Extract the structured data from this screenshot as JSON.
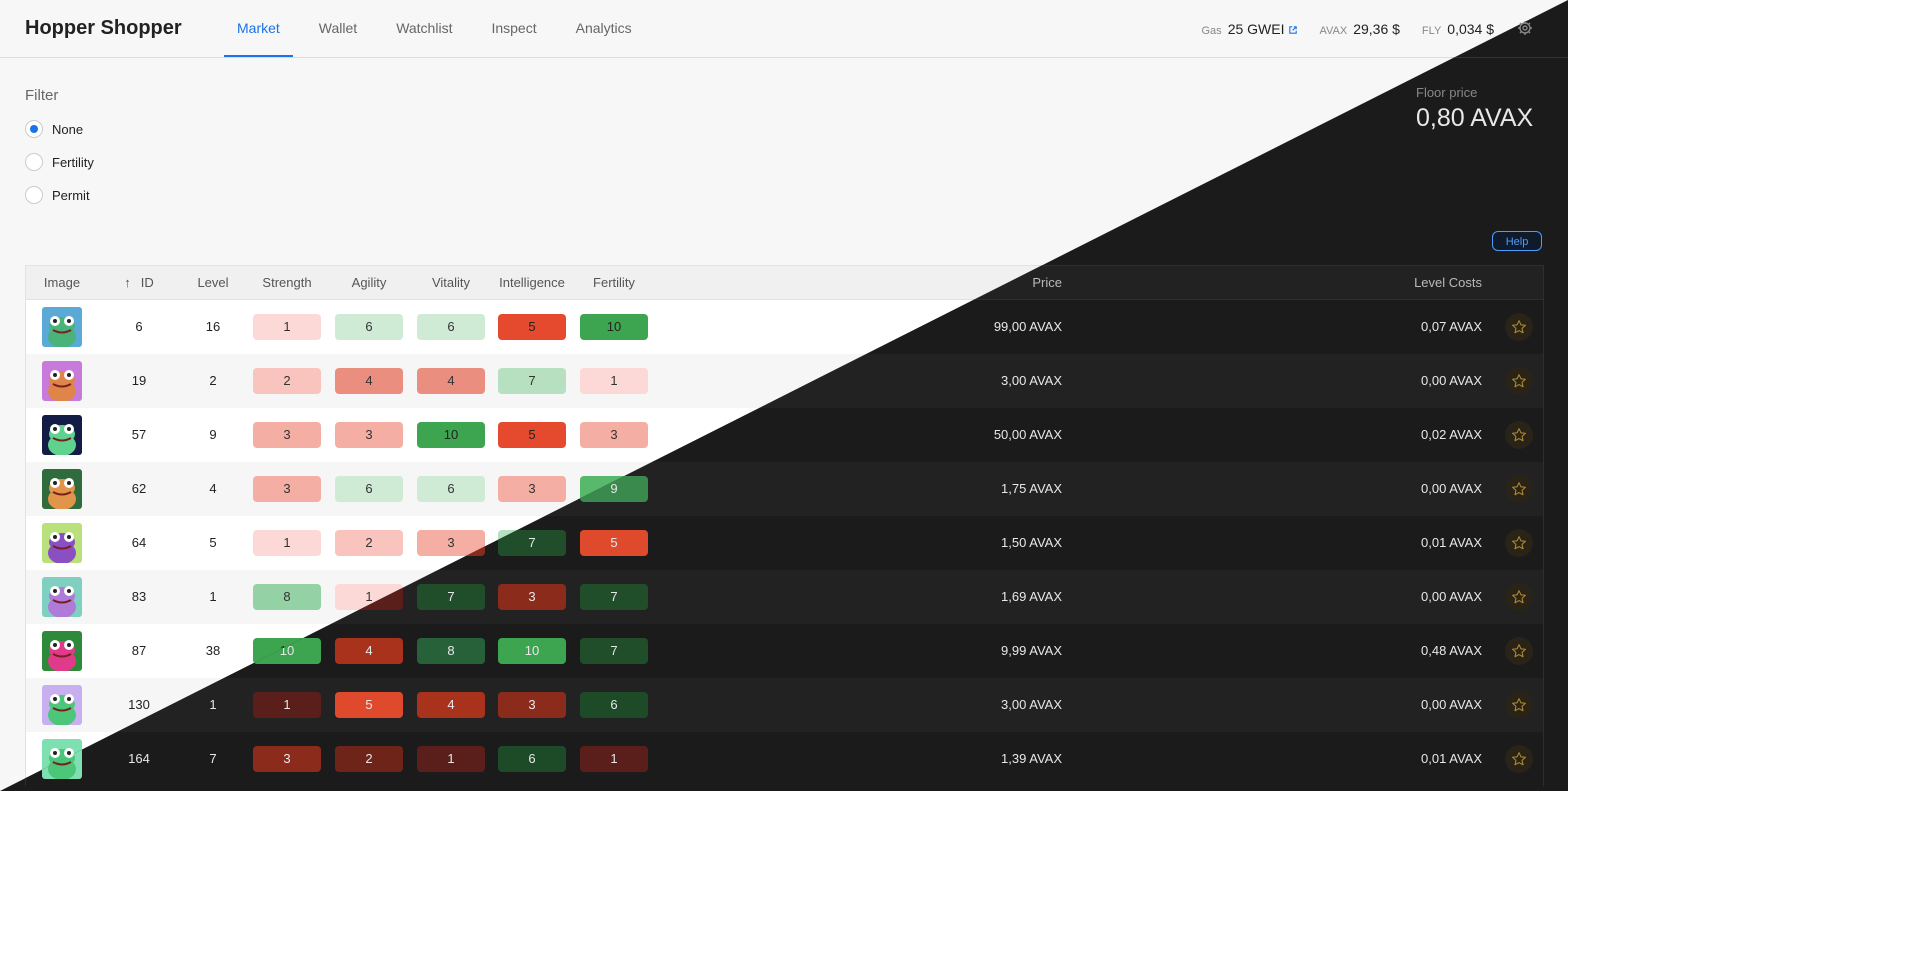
{
  "app": {
    "title": "Hopper Shopper"
  },
  "tabs": [
    {
      "label": "Market",
      "active": true
    },
    {
      "label": "Wallet",
      "active": false
    },
    {
      "label": "Watchlist",
      "active": false
    },
    {
      "label": "Inspect",
      "active": false
    },
    {
      "label": "Analytics",
      "active": false
    }
  ],
  "stats": {
    "gas": {
      "label": "Gas",
      "value": "25 GWEI"
    },
    "avax": {
      "label": "AVAX",
      "value": "29,36 $"
    },
    "fly": {
      "label": "FLY",
      "value": "0,034 $"
    }
  },
  "filter": {
    "title": "Filter",
    "options": [
      {
        "label": "None",
        "selected": true
      },
      {
        "label": "Fertility",
        "selected": false
      },
      {
        "label": "Permit",
        "selected": false
      }
    ]
  },
  "floor": {
    "label": "Floor price",
    "value": "0,80 AVAX"
  },
  "help_label": "Help",
  "table": {
    "sort_indicator": "↑",
    "columns": {
      "image": "Image",
      "id": "ID",
      "level": "Level",
      "strength": "Strength",
      "agility": "Agility",
      "vitality": "Vitality",
      "intelligence": "Intelligence",
      "fertility": "Fertility",
      "price": "Price",
      "level_costs": "Level Costs"
    },
    "rows": [
      {
        "id": "6",
        "level": "16",
        "stats": [
          "1",
          "6",
          "6",
          "5",
          "10"
        ],
        "price": "99,00 AVAX",
        "level_costs": "0,07 AVAX",
        "bg": "#5aa9d6",
        "skin": "#49b37a"
      },
      {
        "id": "19",
        "level": "2",
        "stats": [
          "2",
          "4",
          "4",
          "7",
          "1"
        ],
        "price": "3,00 AVAX",
        "level_costs": "0,00 AVAX",
        "bg": "#c77ad9",
        "skin": "#e0854a"
      },
      {
        "id": "57",
        "level": "9",
        "stats": [
          "3",
          "3",
          "10",
          "5",
          "3"
        ],
        "price": "50,00 AVAX",
        "level_costs": "0,02 AVAX",
        "bg": "#121c44",
        "skin": "#5fd38d"
      },
      {
        "id": "62",
        "level": "4",
        "stats": [
          "3",
          "6",
          "6",
          "3",
          "9"
        ],
        "price": "1,75 AVAX",
        "level_costs": "0,00 AVAX",
        "bg": "#2f6b3c",
        "skin": "#e0954a"
      },
      {
        "id": "64",
        "level": "5",
        "stats": [
          "1",
          "2",
          "3",
          "7",
          "5"
        ],
        "price": "1,50 AVAX",
        "level_costs": "0,01 AVAX",
        "bg": "#b9e07a",
        "skin": "#8a4fc2"
      },
      {
        "id": "83",
        "level": "1",
        "stats": [
          "8",
          "1",
          "7",
          "3",
          "7"
        ],
        "price": "1,69 AVAX",
        "level_costs": "0,00 AVAX",
        "bg": "#7fd0c0",
        "skin": "#b07ad9"
      },
      {
        "id": "87",
        "level": "38",
        "stats": [
          "10",
          "4",
          "8",
          "10",
          "7"
        ],
        "price": "9,99 AVAX",
        "level_costs": "0,48 AVAX",
        "bg": "#2d8a3a",
        "skin": "#e03a8a"
      },
      {
        "id": "130",
        "level": "1",
        "stats": [
          "1",
          "5",
          "4",
          "3",
          "6"
        ],
        "price": "3,00 AVAX",
        "level_costs": "0,00 AVAX",
        "bg": "#c8b0f0",
        "skin": "#4cc77a"
      },
      {
        "id": "164",
        "level": "7",
        "stats": [
          "3",
          "2",
          "1",
          "6",
          "1"
        ],
        "price": "1,39 AVAX",
        "level_costs": "0,01 AVAX",
        "bg": "#7ee0b0",
        "skin": "#4cc77a"
      }
    ]
  },
  "colors": {
    "accent_light": "#1a73e8",
    "accent_dark": "#4d9cff",
    "stat_light": {
      "1": "#fcd9d6",
      "2": "#f9c4bd",
      "3": "#f4aea3",
      "4": "#ea8f80",
      "5": "#e64a2e",
      "6": "#cfead5",
      "7": "#b6e0c0",
      "8": "#94d1a4",
      "9": "#58b86c",
      "10": "#3da54f"
    },
    "stat_dark": {
      "1": "#5a1f1a",
      "2": "#6e2418",
      "3": "#8a2b1c",
      "4": "#a8321c",
      "5": "#e04a2c",
      "6": "#1d4a27",
      "7": "#204d2a",
      "8": "#27613a",
      "9": "#3a8a4d",
      "10": "#3da54f"
    }
  }
}
